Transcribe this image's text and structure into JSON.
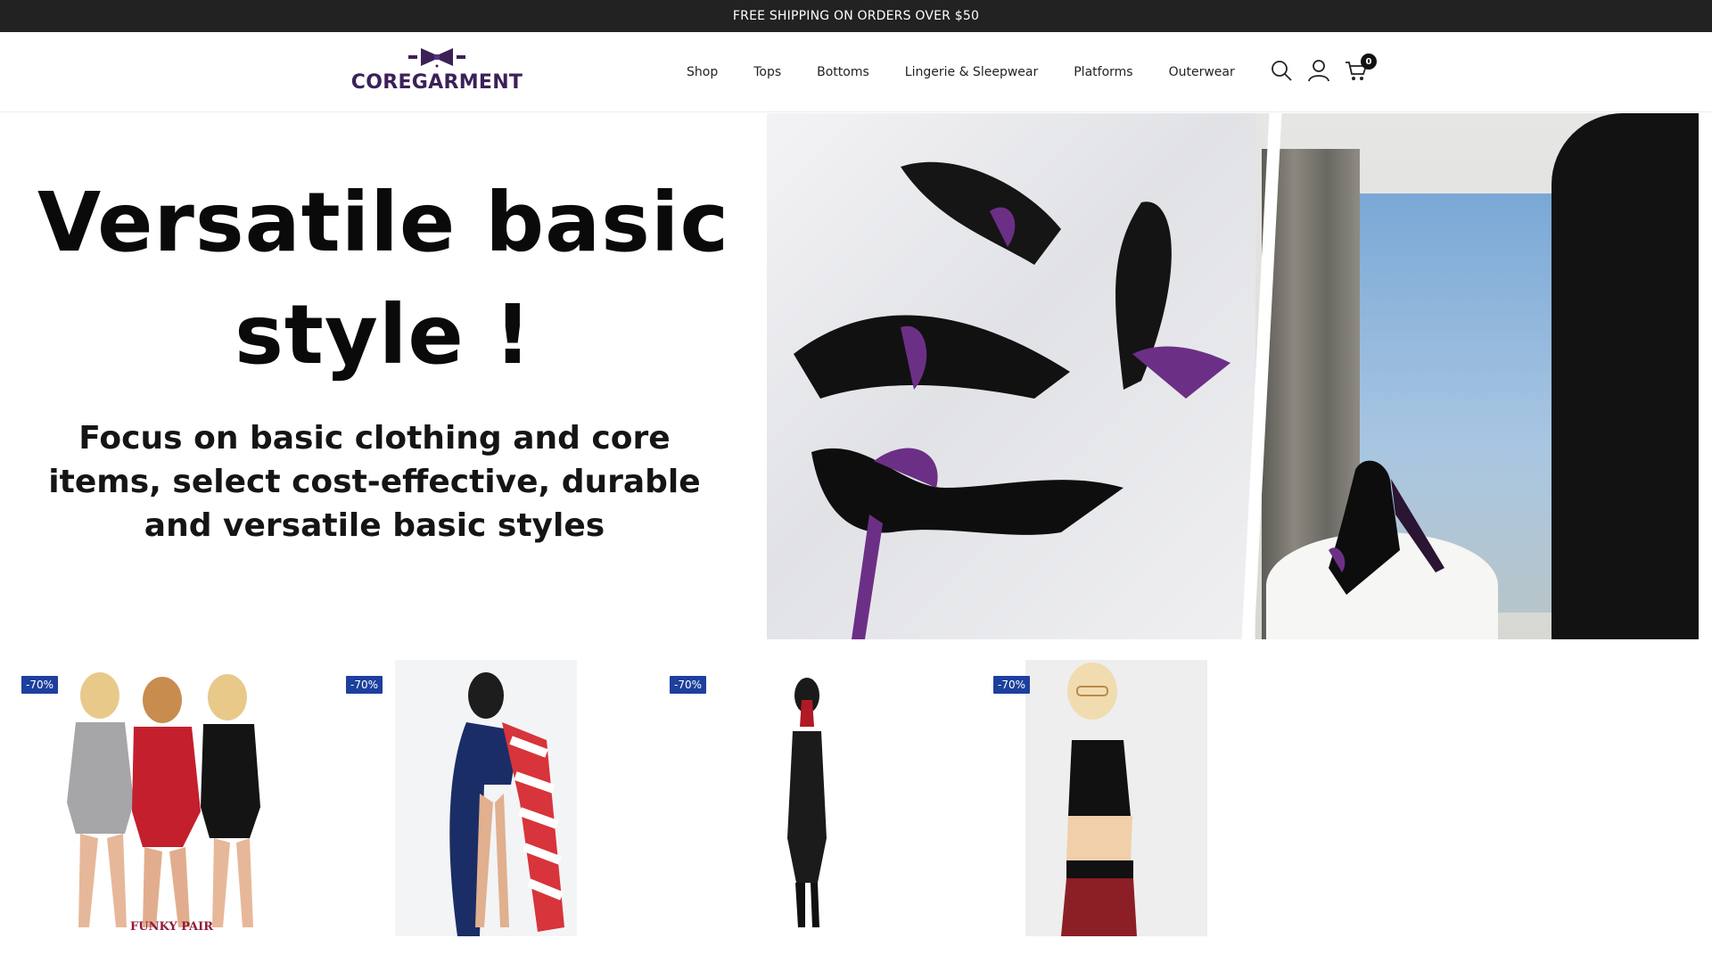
{
  "announcement": "FREE SHIPPING ON ORDERS OVER $50",
  "brand": {
    "name": "COREGARMENT",
    "color": "#3b2158"
  },
  "nav": [
    "Shop",
    "Tops",
    "Bottoms",
    "Lingerie & Sleepwear",
    "Platforms",
    "Outerwear"
  ],
  "header_icons": {
    "search": "search-icon",
    "account": "user-icon",
    "cart": "cart-icon",
    "cart_count": "0"
  },
  "hero": {
    "title_line1": "Versatile basic",
    "title_line2": "style !",
    "subtitle": "Focus on basic clothing and core items, select cost-effective, durable and versatile basic styles"
  },
  "products": [
    {
      "badge": "-70%",
      "image_caption": "FUNKY PAIR"
    },
    {
      "badge": "-70%"
    },
    {
      "badge": "-70%"
    },
    {
      "badge": "-70%"
    }
  ],
  "colors": {
    "announce_bg": "#222222",
    "badge_bg": "#1d3f9e"
  }
}
